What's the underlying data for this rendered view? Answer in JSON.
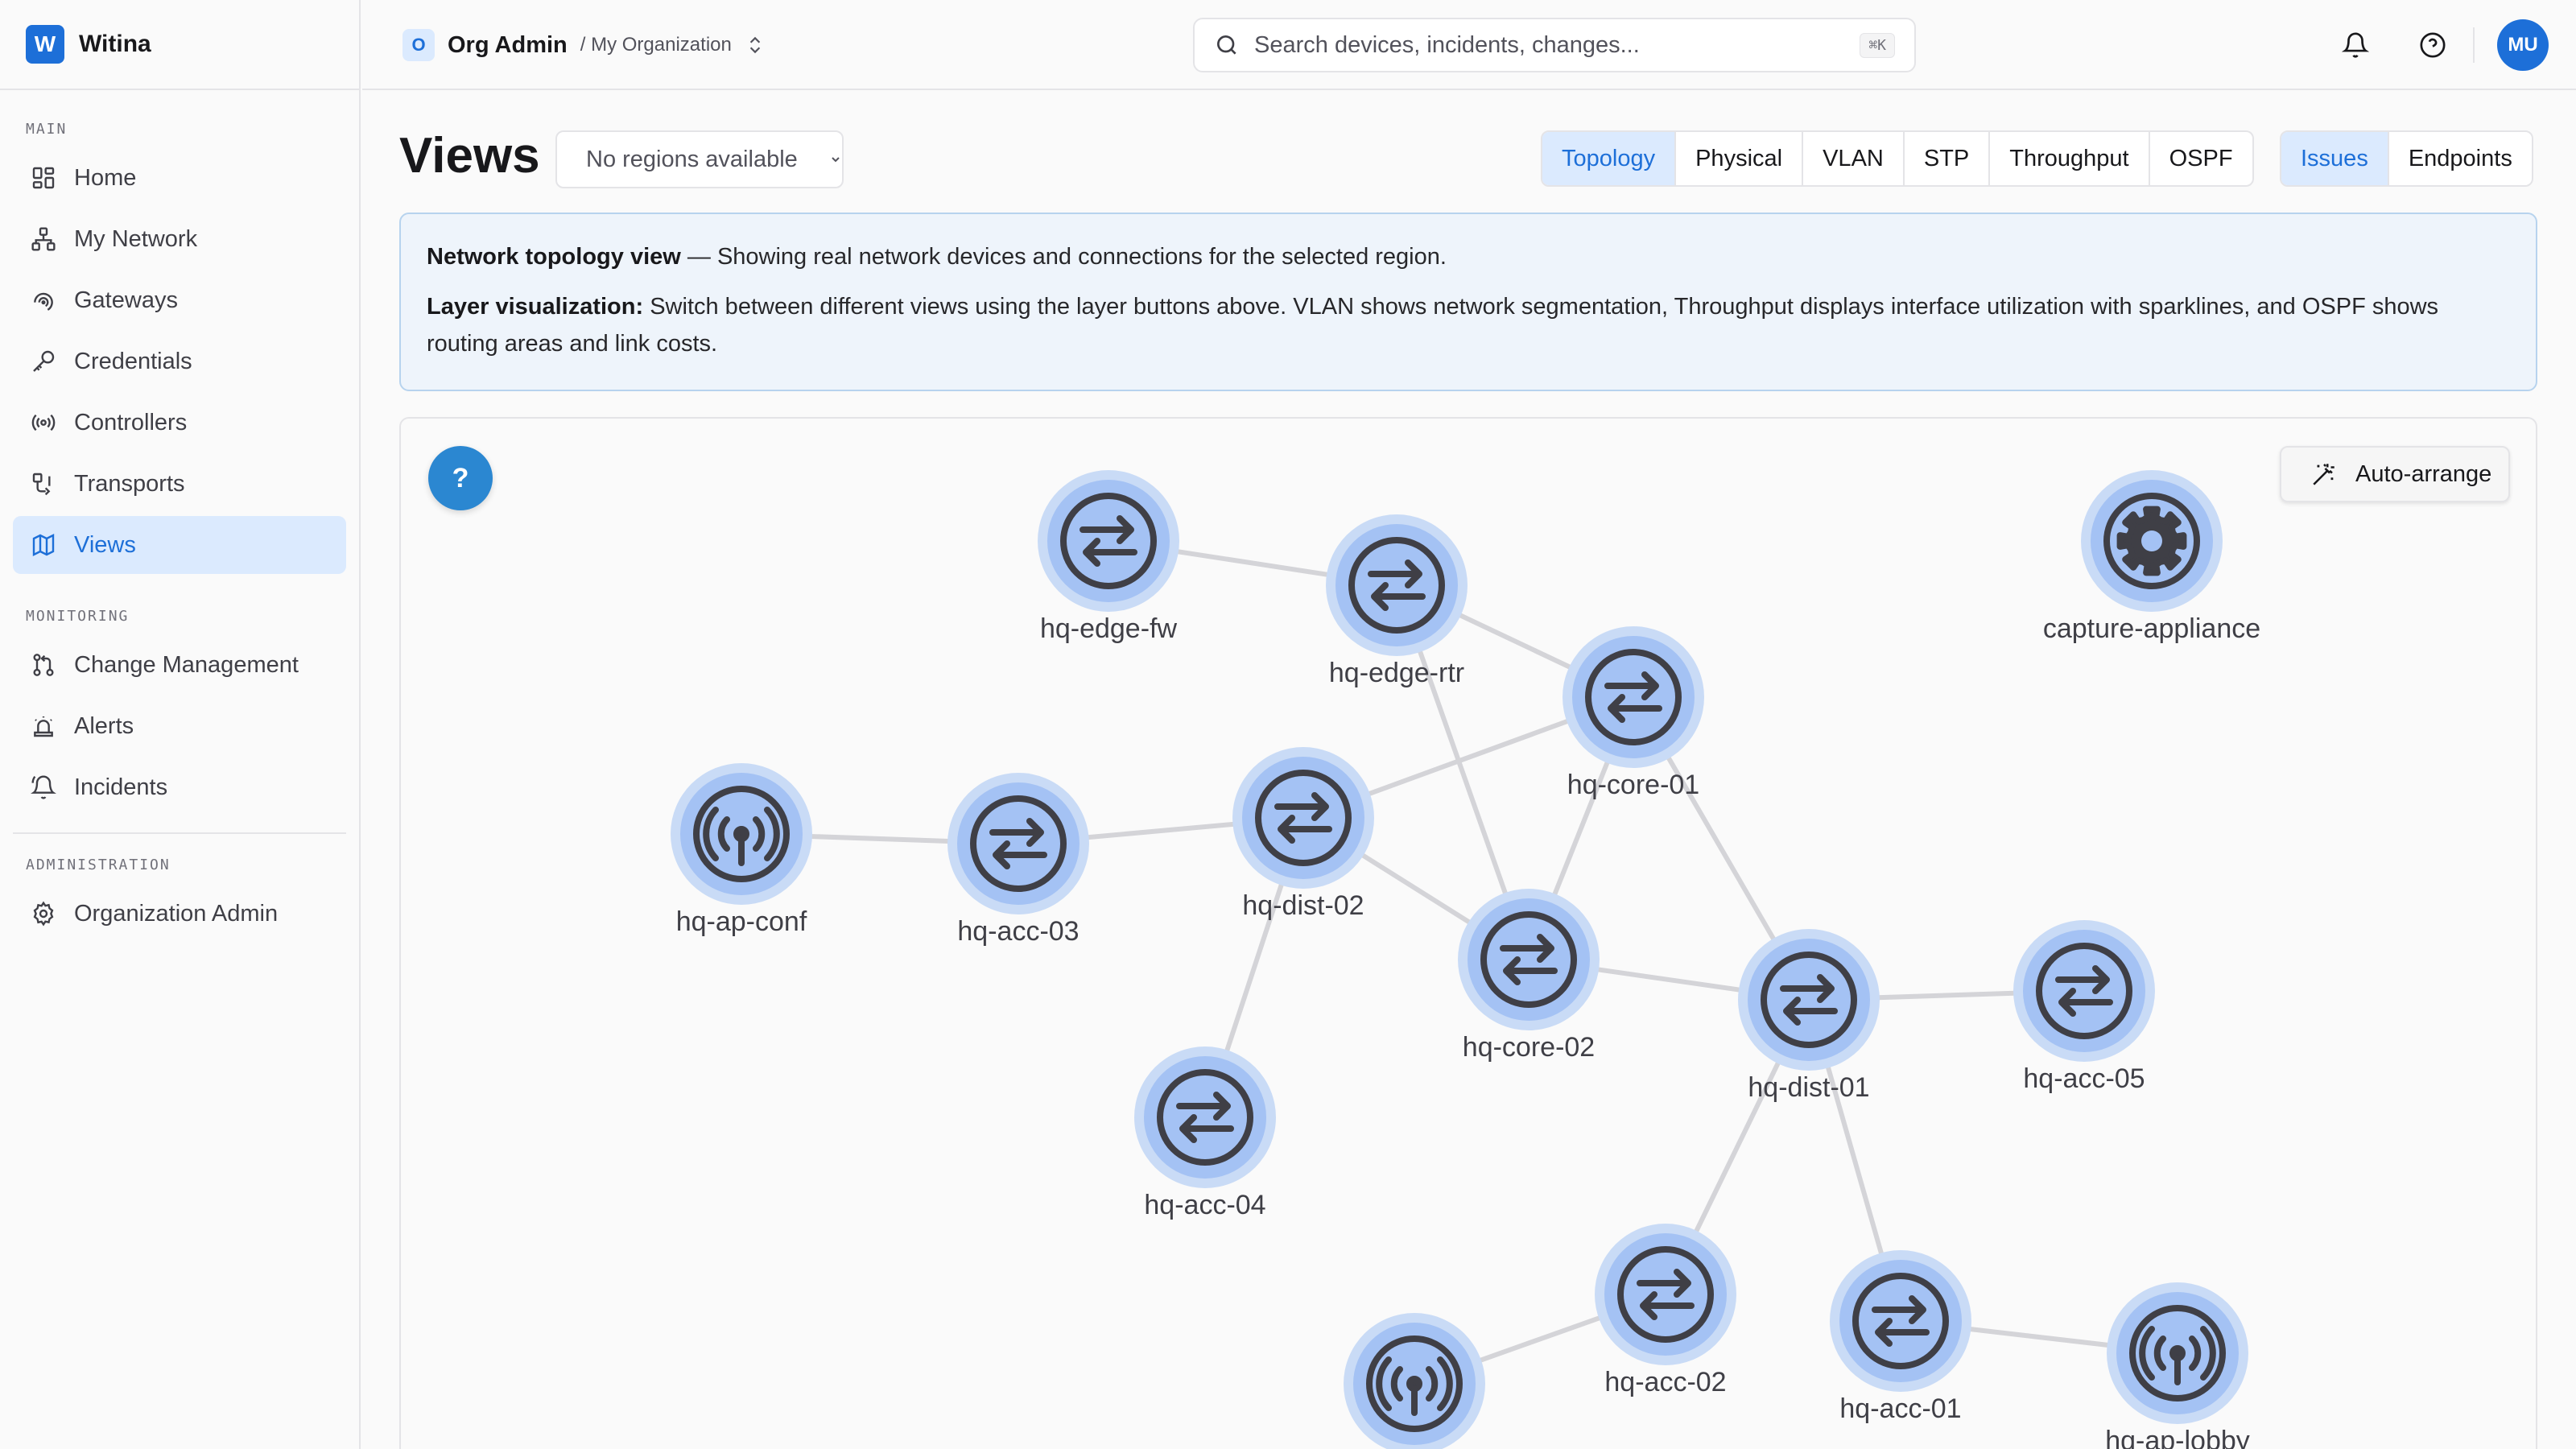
{
  "brand": {
    "logo_letter": "W",
    "name": "Witina"
  },
  "sidebar": {
    "sections": [
      {
        "heading": "MAIN",
        "items": [
          {
            "label": "Home",
            "icon": "grid-icon"
          },
          {
            "label": "My Network",
            "icon": "network-icon"
          },
          {
            "label": "Gateways",
            "icon": "gateway-icon"
          },
          {
            "label": "Credentials",
            "icon": "key-icon"
          },
          {
            "label": "Controllers",
            "icon": "broadcast-icon"
          },
          {
            "label": "Transports",
            "icon": "transport-icon"
          },
          {
            "label": "Views",
            "icon": "map-icon",
            "active": true
          }
        ]
      },
      {
        "heading": "MONITORING",
        "items": [
          {
            "label": "Change Management",
            "icon": "git-pull-request-icon"
          },
          {
            "label": "Alerts",
            "icon": "siren-icon"
          },
          {
            "label": "Incidents",
            "icon": "bell-ring-icon"
          }
        ]
      },
      {
        "heading": "ADMINISTRATION",
        "items": [
          {
            "label": "Organization Admin",
            "icon": "gear-icon"
          }
        ]
      }
    ]
  },
  "header": {
    "org_badge": "O",
    "org_name": "Org Admin",
    "org_sub": "/ My Organization",
    "search_placeholder": "Search devices, incidents, changes...",
    "search_shortcut": "⌘K",
    "avatar_initials": "MU"
  },
  "main": {
    "title": "Views",
    "region_select": {
      "selected": "No regions available"
    },
    "layers": [
      {
        "label": "Topology",
        "active": true
      },
      {
        "label": "Physical"
      },
      {
        "label": "VLAN"
      },
      {
        "label": "STP"
      },
      {
        "label": "Throughput"
      },
      {
        "label": "OSPF"
      }
    ],
    "overlays": [
      {
        "label": "Issues",
        "active": true
      },
      {
        "label": "Endpoints"
      }
    ],
    "info": {
      "line1_bold": "Network topology view",
      "line1_rest": " — Showing real network devices and connections for the selected region.",
      "line2_bold": "Layer visualization:",
      "line2_rest": " Switch between different views using the layer buttons above. VLAN shows network segmentation, Throughput displays interface utilization with sparklines, and OSPF shows routing areas and link costs."
    },
    "help_label": "?",
    "auto_arrange_label": "Auto-arrange"
  },
  "topology": {
    "colors": {
      "node_fill": "#a4c2f4",
      "node_ring": "#c9dbf6",
      "icon": "#3f3f46",
      "link": "#d4d4d8"
    },
    "nodes": [
      {
        "id": "hq-edge-fw",
        "type": "switch"
      },
      {
        "id": "hq-edge-rtr",
        "type": "switch"
      },
      {
        "id": "capture-appliance",
        "type": "appliance"
      },
      {
        "id": "hq-core-01",
        "type": "switch"
      },
      {
        "id": "hq-ap-conf",
        "type": "ap"
      },
      {
        "id": "hq-acc-03",
        "type": "switch"
      },
      {
        "id": "hq-dist-02",
        "type": "switch"
      },
      {
        "id": "hq-core-02",
        "type": "switch"
      },
      {
        "id": "hq-dist-01",
        "type": "switch"
      },
      {
        "id": "hq-acc-05",
        "type": "switch"
      },
      {
        "id": "hq-acc-04",
        "type": "switch"
      },
      {
        "id": "hq-acc-02",
        "type": "switch"
      },
      {
        "id": "hq-acc-01",
        "type": "switch"
      },
      {
        "id": "hq-ap-lobby",
        "type": "ap"
      },
      {
        "id": "",
        "type": "ap"
      }
    ],
    "links": [
      [
        "hq-edge-fw",
        "hq-edge-rtr"
      ],
      [
        "hq-edge-rtr",
        "hq-core-01"
      ],
      [
        "hq-edge-rtr",
        "hq-core-02"
      ],
      [
        "hq-core-01",
        "hq-dist-02"
      ],
      [
        "hq-core-01",
        "hq-core-02"
      ],
      [
        "hq-core-01",
        "hq-dist-01"
      ],
      [
        "hq-ap-conf",
        "hq-acc-03"
      ],
      [
        "hq-acc-03",
        "hq-dist-02"
      ],
      [
        "hq-dist-02",
        "hq-core-02"
      ],
      [
        "hq-dist-02",
        "hq-acc-04"
      ],
      [
        "hq-core-02",
        "hq-dist-01"
      ],
      [
        "hq-dist-01",
        "hq-acc-05"
      ],
      [
        "hq-dist-01",
        "hq-acc-02"
      ],
      [
        "hq-dist-01",
        "hq-acc-01"
      ],
      [
        "hq-acc-01",
        "hq-ap-lobby"
      ],
      [
        "hq-acc-02",
        ""
      ]
    ]
  }
}
